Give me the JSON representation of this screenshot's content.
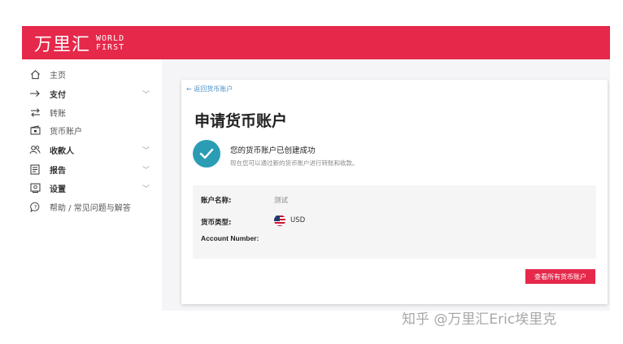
{
  "header": {
    "logo_cn": "万里汇",
    "logo_en_line1": "WORLD",
    "logo_en_line2": "FIRST",
    "brand_color": "#e6284a"
  },
  "sidebar": {
    "items": [
      {
        "label": "主页",
        "icon": "home-icon",
        "expandable": false,
        "bold": false
      },
      {
        "label": "支付",
        "icon": "arrow-right-icon",
        "expandable": true,
        "bold": true
      },
      {
        "label": "转账",
        "icon": "transfer-icon",
        "expandable": false,
        "bold": false
      },
      {
        "label": "货币账户",
        "icon": "wallet-icon",
        "expandable": false,
        "bold": false
      },
      {
        "label": "收款人",
        "icon": "people-icon",
        "expandable": true,
        "bold": true
      },
      {
        "label": "报告",
        "icon": "report-icon",
        "expandable": true,
        "bold": true
      },
      {
        "label": "设置",
        "icon": "settings-icon",
        "expandable": true,
        "bold": true
      },
      {
        "label": "帮助 / 常见问题与解答",
        "icon": "help-icon",
        "expandable": false,
        "bold": false
      }
    ]
  },
  "main": {
    "back_link": "← 返回货币账户",
    "title": "申请货币账户",
    "success_title": "您的货币账户已创建成功",
    "success_subtitle": "现在您可以通过新的货币账户进行转账和收款。",
    "check_color": "#2a9db5",
    "info": {
      "account_name_label": "账户名称:",
      "account_name_value": "测试",
      "currency_label": "货币类型:",
      "currency_value": "USD",
      "currency_icon": "us-flag-icon",
      "account_number_label": "Account Number:"
    },
    "view_all_button": "查看所有货币账户"
  },
  "watermark": "知乎 @万里汇Eric埃里克"
}
